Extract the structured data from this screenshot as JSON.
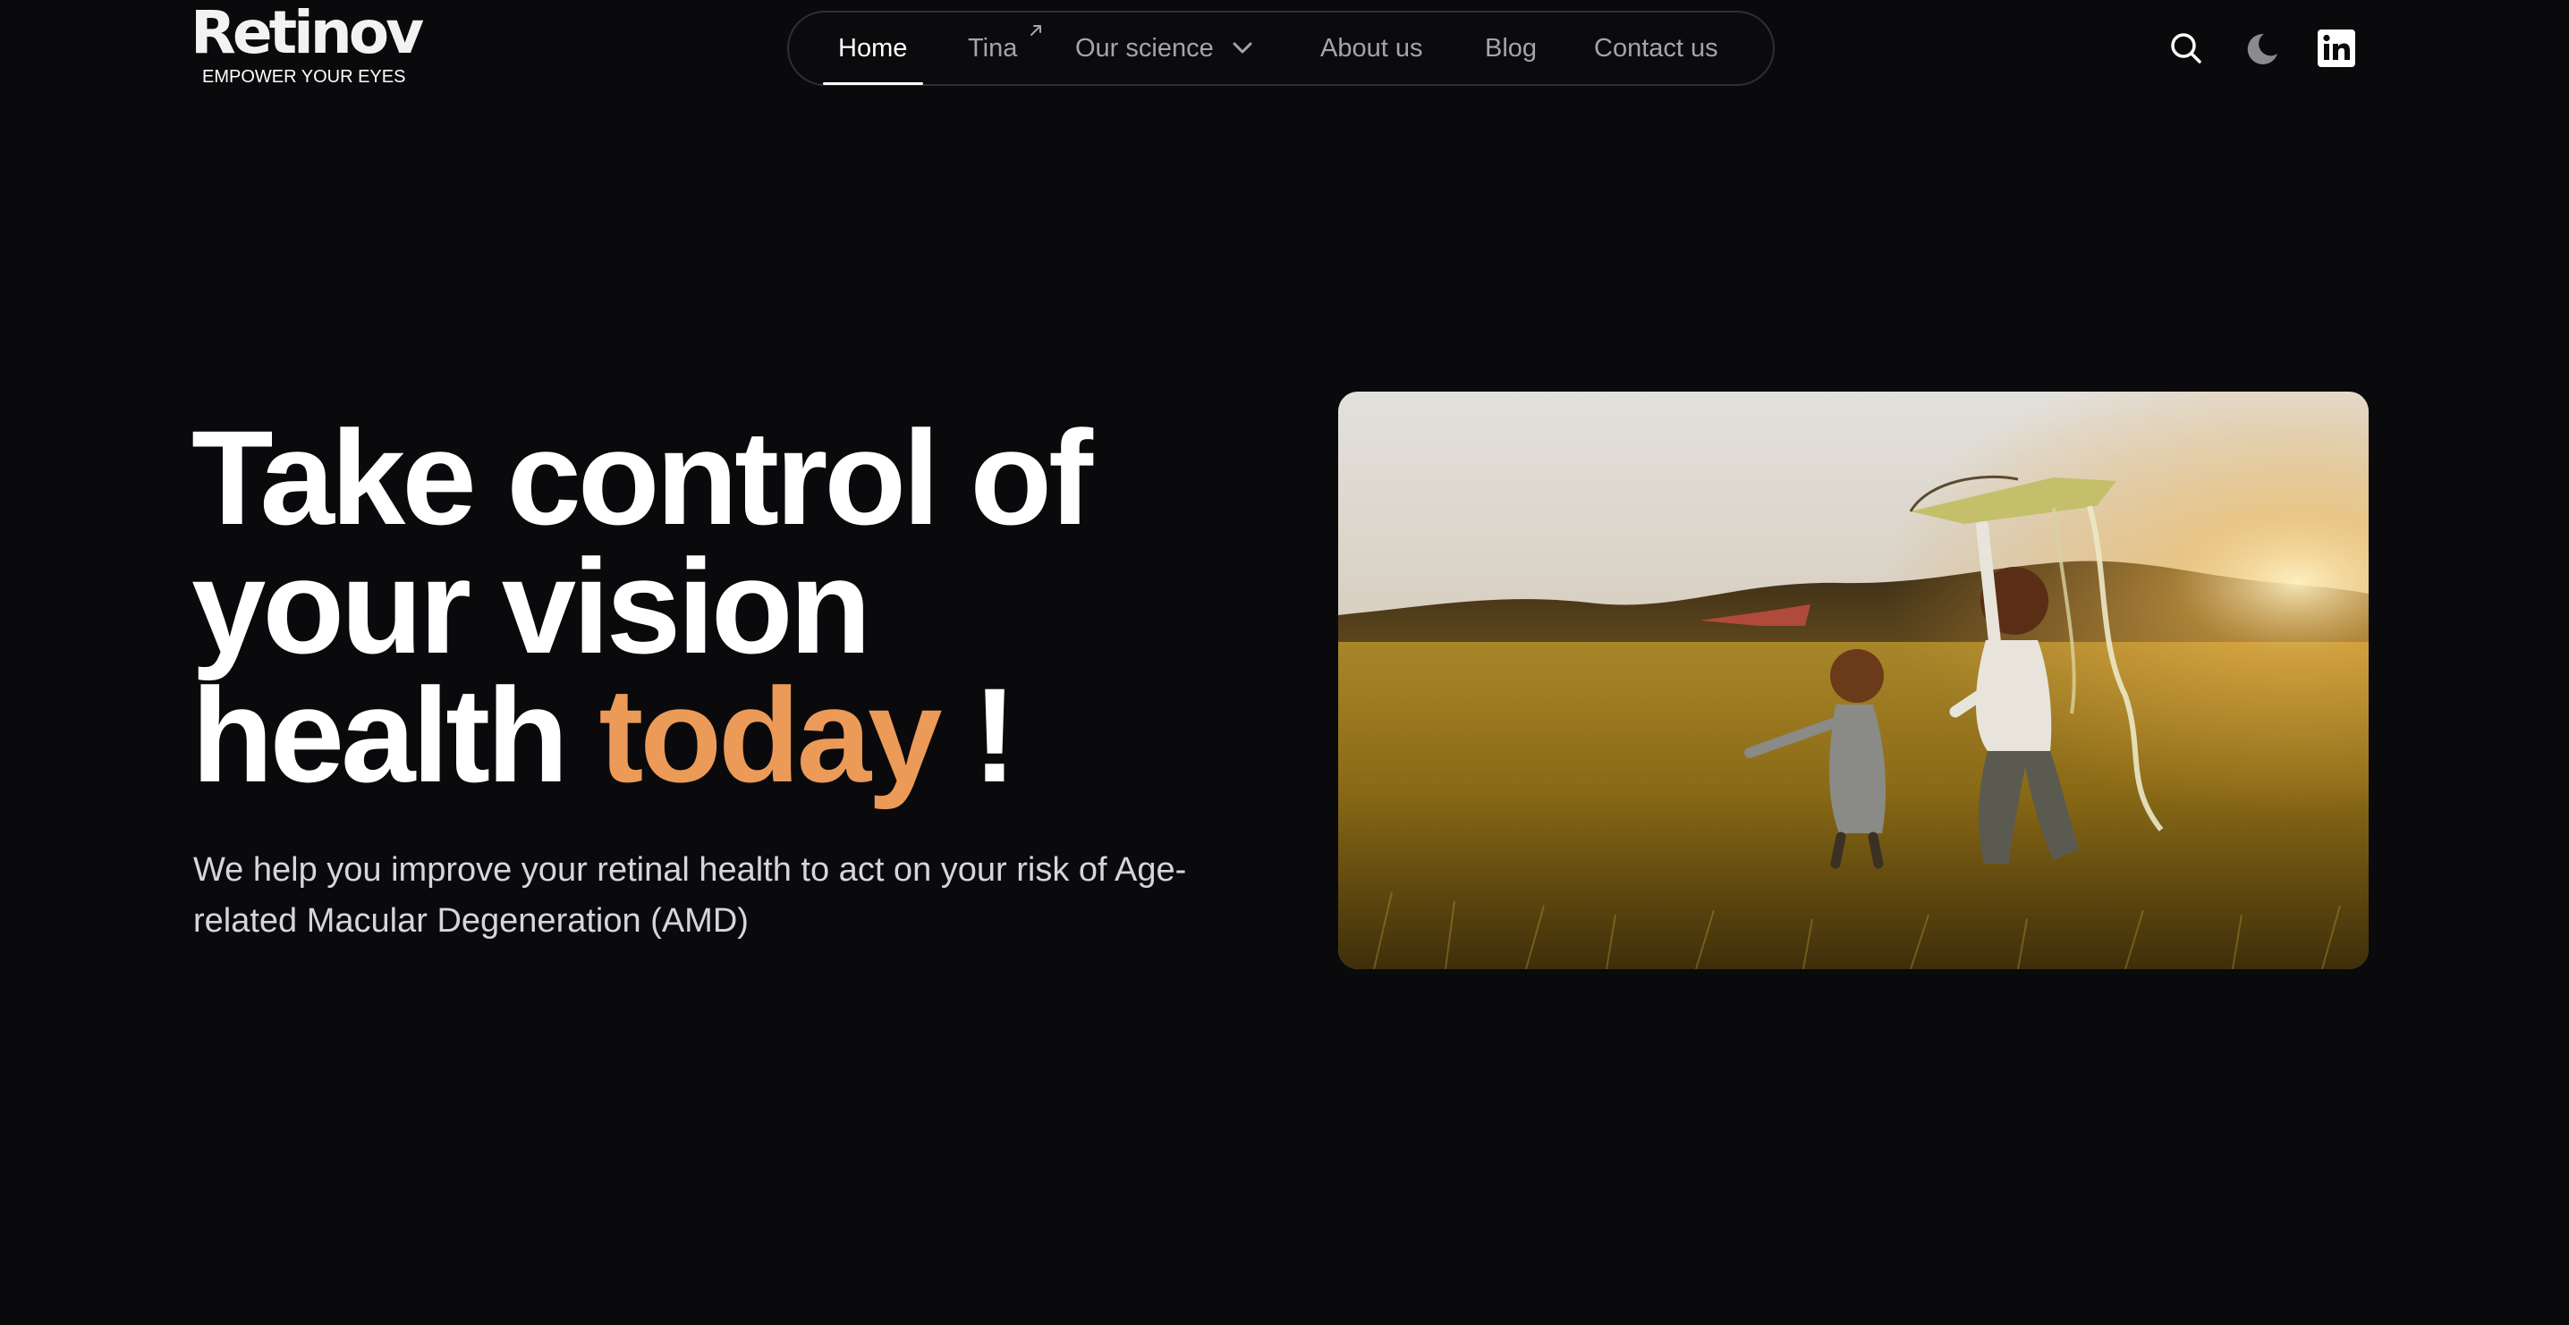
{
  "brand": {
    "name": "Retinov",
    "tagline": "EMPOWER YOUR EYES"
  },
  "nav": {
    "items": [
      {
        "label": "Home",
        "active": true
      },
      {
        "label": "Tina",
        "external": true
      },
      {
        "label": "Our science",
        "has_dropdown": true
      },
      {
        "label": "About us"
      },
      {
        "label": "Blog"
      },
      {
        "label": "Contact us"
      }
    ]
  },
  "header_icons": [
    "search-icon",
    "moon-icon",
    "linkedin-icon"
  ],
  "hero": {
    "title_line1": "Take control of",
    "title_line2": "your vision",
    "title_line3_start": "health ",
    "title_accent": "today",
    "title_line3_end": " !",
    "subtitle": "We help you improve your retinal health to act on your risk of Age-related Macular Degeneration (AMD)",
    "image_alt": "Two children running with kites in a golden wheat field at sunset"
  },
  "colors": {
    "background": "#0a0a0c",
    "accent": "#ec9a58",
    "nav_text": "#a4a4aa",
    "nav_border": "#2f2f33"
  }
}
